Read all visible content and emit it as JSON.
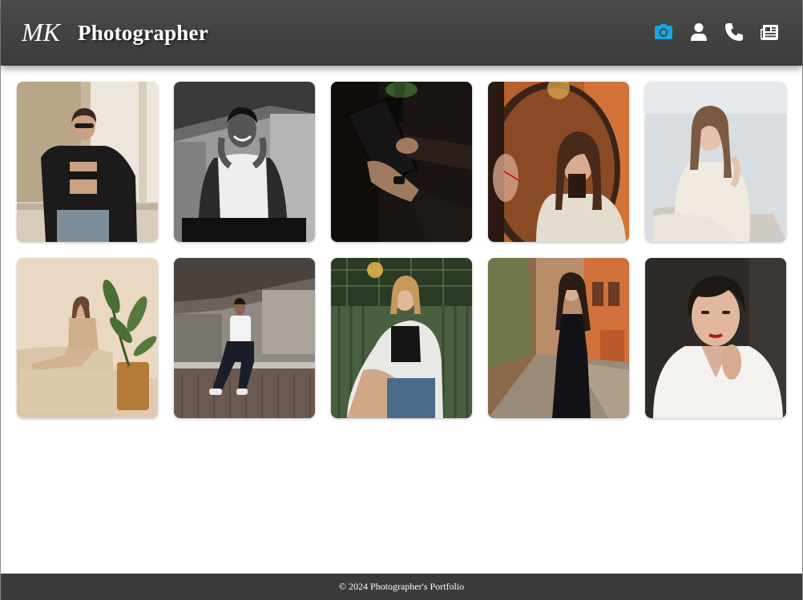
{
  "header": {
    "logo_text": "MK",
    "brand": "Photographer",
    "nav": [
      {
        "icon": "camera-icon",
        "active": true
      },
      {
        "icon": "user-icon",
        "active": false
      },
      {
        "icon": "phone-icon",
        "active": false
      },
      {
        "icon": "newspaper-icon",
        "active": false
      }
    ]
  },
  "colors": {
    "header_bg": "#444444",
    "footer_bg": "#3b3b3b",
    "accent": "#1aa3e0",
    "icon": "#ffffff"
  },
  "gallery": {
    "items": [
      {
        "subject": "woman in black jacket and sunglasses by window"
      },
      {
        "subject": "smiling man in white tank top, black and white"
      },
      {
        "subject": "hands holding a tablet in dark room"
      },
      {
        "subject": "woman applying lipstick in round mirror"
      },
      {
        "subject": "woman in cream sweater, studio portrait"
      },
      {
        "subject": "woman sitting on beige sofa next to plant"
      },
      {
        "subject": "man in white tank top sitting on concrete ledge"
      },
      {
        "subject": "young woman seated against green wall"
      },
      {
        "subject": "woman in black dress on narrow street"
      },
      {
        "subject": "woman with short hair in white shirt"
      }
    ]
  },
  "footer": {
    "text": "© 2024 Photographer's Portfolio"
  }
}
